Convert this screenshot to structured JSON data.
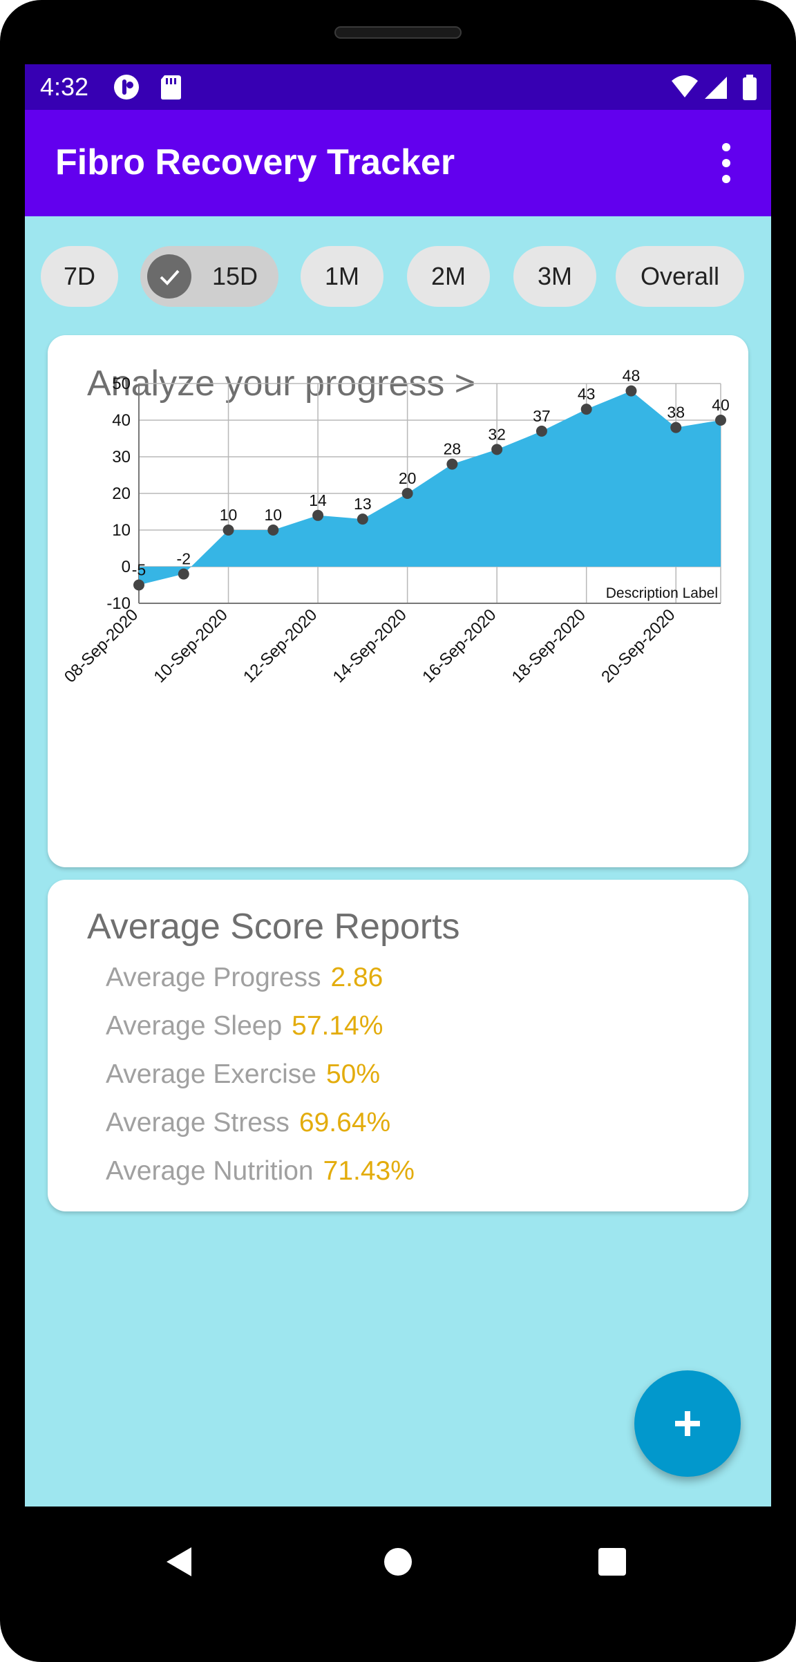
{
  "status_bar": {
    "time": "4:32",
    "icons": [
      "notification-app-icon",
      "sd-card-icon",
      "wifi-icon",
      "cell-signal-icon",
      "battery-icon"
    ]
  },
  "app_bar": {
    "title": "Fibro Recovery Tracker",
    "menu_icon": "more-vert-icon"
  },
  "filters": {
    "chips": [
      {
        "label": "7D",
        "selected": false
      },
      {
        "label": "15D",
        "selected": true
      },
      {
        "label": "1M",
        "selected": false
      },
      {
        "label": "2M",
        "selected": false
      },
      {
        "label": "3M",
        "selected": false
      },
      {
        "label": "Overall",
        "selected": false
      }
    ]
  },
  "progress_card": {
    "title": "Analyze your progress >"
  },
  "chart_data": {
    "type": "area",
    "x": [
      "08-Sep-2020",
      "09-Sep-2020",
      "10-Sep-2020",
      "11-Sep-2020",
      "12-Sep-2020",
      "13-Sep-2020",
      "14-Sep-2020",
      "15-Sep-2020",
      "16-Sep-2020",
      "17-Sep-2020",
      "18-Sep-2020",
      "19-Sep-2020",
      "20-Sep-2020",
      "21-Sep-2020"
    ],
    "values": [
      -5,
      -2,
      10,
      10,
      14,
      13,
      20,
      28,
      32,
      37,
      43,
      48,
      38,
      40
    ],
    "x_tick_labels": [
      "08-Sep-2020",
      "10-Sep-2020",
      "12-Sep-2020",
      "14-Sep-2020",
      "16-Sep-2020",
      "18-Sep-2020",
      "20-Sep-2020"
    ],
    "y_ticks": [
      50,
      40,
      30,
      20,
      10,
      0,
      -10
    ],
    "ylim": [
      -10,
      50
    ],
    "description": "Description Label",
    "fill_color": "#36b5e5",
    "point_color": "#444444",
    "grid": true
  },
  "reports_card": {
    "title": "Average Score Reports",
    "rows": [
      {
        "label": "Average Progress",
        "value": "2.86"
      },
      {
        "label": "Average Sleep",
        "value": "57.14%"
      },
      {
        "label": "Average Exercise",
        "value": "50%"
      },
      {
        "label": "Average Stress",
        "value": "69.64%"
      },
      {
        "label": "Average Nutrition",
        "value": "71.43%"
      }
    ]
  },
  "fab": {
    "icon": "add-icon"
  },
  "nav_bar": {
    "icons": [
      "back-icon",
      "home-icon",
      "recents-icon"
    ]
  },
  "colors": {
    "status_bar": "#3700b3",
    "app_bar": "#6200ee",
    "background": "#9ee6ef",
    "value_text": "#e3ac0c",
    "fab": "#0298cc"
  }
}
